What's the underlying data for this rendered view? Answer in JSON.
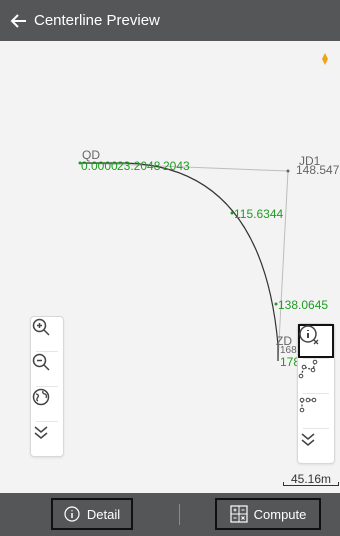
{
  "header": {
    "title": "Centerline Preview",
    "back_icon": "arrow-left-icon"
  },
  "map": {
    "labels": {
      "qd": "QD",
      "qd_chainage": "0.0000",
      "qd_overlap": "23.2048",
      "qd_overlap2": "2043",
      "jd1": "JD1",
      "jd1_chainage": "148.547",
      "mid": "115.6344",
      "lower": "138.0645",
      "zd": "ZD",
      "zd_value": "178",
      "zd_hidden": "168"
    },
    "scale_label": "45.16m",
    "colors": {
      "accent_green": "#1f9c22",
      "curve": "#333333",
      "tangent": "#bdbdbd"
    }
  },
  "left_tools": [
    {
      "name": "zoom-in-icon"
    },
    {
      "name": "zoom-out-icon"
    },
    {
      "name": "globe-icon"
    },
    {
      "name": "chevron-double-down-icon"
    }
  ],
  "right_tools": [
    {
      "name": "info-x-icon"
    },
    {
      "name": "polyline-nodes-icon"
    },
    {
      "name": "path-nodes-icon"
    },
    {
      "name": "chevron-double-down-icon"
    }
  ],
  "footer": {
    "detail_label": "Detail",
    "compute_label": "Compute"
  }
}
